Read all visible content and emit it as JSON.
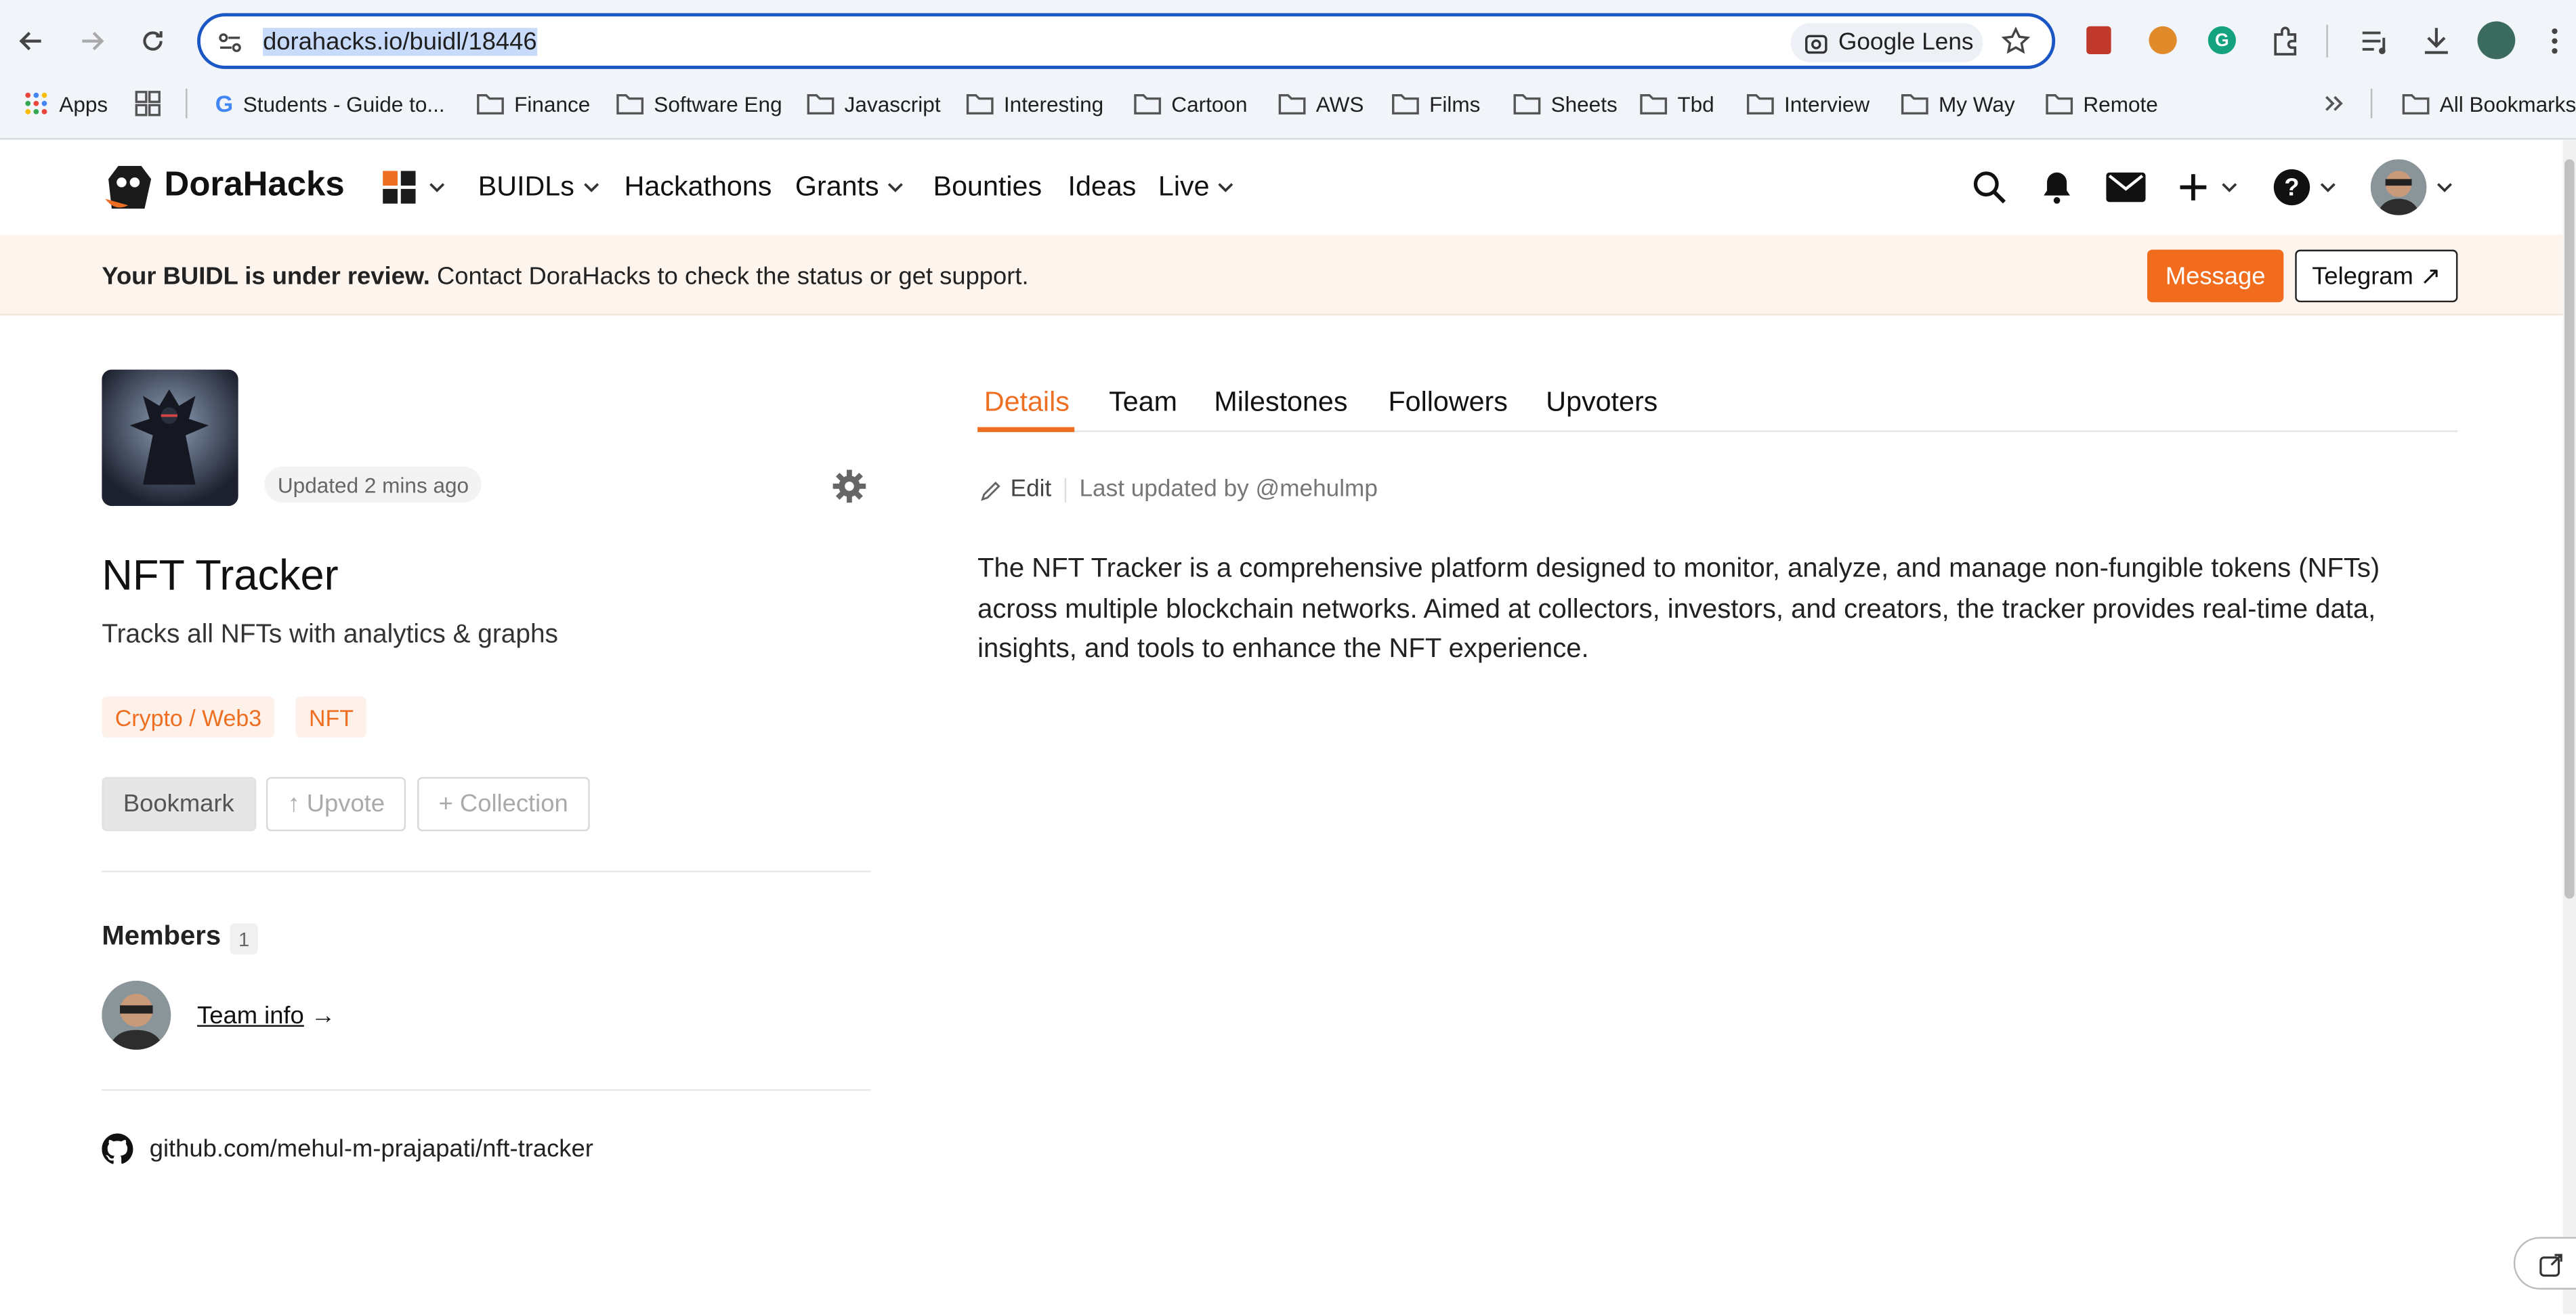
{
  "browser": {
    "url_host": "dorahacks.io",
    "url_path": "/buidl/18446",
    "lens_label": "Google Lens",
    "bookmarks": [
      "Apps",
      "Students - Guide to...",
      "Finance",
      "Software Eng",
      "Javascript",
      "Interesting",
      "Cartoon",
      "AWS",
      "Films",
      "Sheets",
      "Tbd",
      "Interview",
      "My Way",
      "Remote"
    ],
    "all_bookmarks": "All Bookmarks"
  },
  "site": {
    "brand": "DoraHacks",
    "nav": [
      "BUIDLs",
      "Hackathons",
      "Grants",
      "Bounties",
      "Ideas",
      "Live"
    ],
    "accent": "#ee6f22"
  },
  "banner": {
    "bold": "Your BUIDL is under review.",
    "text": " Contact DoraHacks to check the status or get support.",
    "message_btn": "Message",
    "telegram_btn": "Telegram ↗"
  },
  "project": {
    "updated": "Updated 2 mins ago",
    "title": "NFT Tracker",
    "subtitle": "Tracks all NFTs with analytics & graphs",
    "tags": [
      "Crypto / Web3",
      "NFT"
    ],
    "actions": {
      "bookmark": "Bookmark",
      "upvote": "↑ Upvote",
      "collection": "+ Collection"
    },
    "members_label": "Members",
    "members_count": "1",
    "team_info": "Team info",
    "team_arrow": " →",
    "github": "github.com/mehul-m-prajapati/nft-tracker"
  },
  "tabs": [
    "Details",
    "Team",
    "Milestones",
    "Followers",
    "Upvoters"
  ],
  "details": {
    "edit": "Edit",
    "last_updated": "Last updated by @mehulmp",
    "description": "The NFT Tracker is a comprehensive platform designed to monitor, analyze, and manage non-fungible tokens (NFTs) across multiple blockchain networks. Aimed at collectors, investors, and creators, the tracker provides real-time data, insights, and tools to enhance the NFT experience."
  }
}
